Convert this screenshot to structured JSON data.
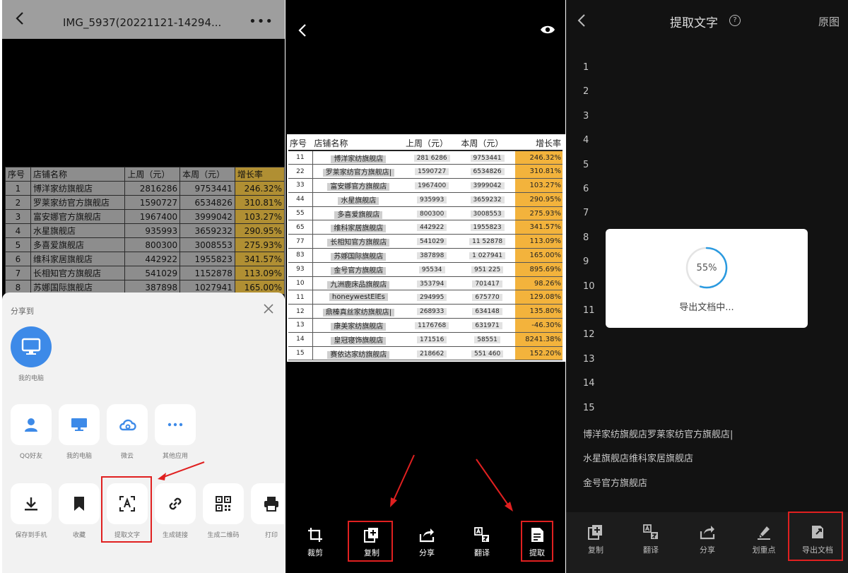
{
  "panel1": {
    "title": "IMG_5937(20221121-14294...",
    "more": "•••",
    "table": {
      "headers": [
        "序号",
        "店铺名称",
        "上周（元）",
        "本周（元）",
        "增长率"
      ],
      "rows": [
        [
          "1",
          "博洋家纺旗舰店",
          "2816286",
          "9753441",
          "246.32%"
        ],
        [
          "2",
          "罗莱家纺官方旗舰店",
          "1590727",
          "6534826",
          "310.81%"
        ],
        [
          "3",
          "富安娜官方旗舰店",
          "1967400",
          "3999042",
          "103.27%"
        ],
        [
          "4",
          "水星旗舰店",
          "935993",
          "3659232",
          "290.95%"
        ],
        [
          "5",
          "多喜爱旗舰店",
          "800300",
          "3008553",
          "275.93%"
        ],
        [
          "6",
          "维科家居旗舰店",
          "442922",
          "1955823",
          "341.57%"
        ],
        [
          "7",
          "长相知官方旗舰店",
          "541029",
          "1152878",
          "113.09%"
        ],
        [
          "8",
          "苏娜国际旗舰店",
          "387898",
          "1027941",
          "165.00%"
        ]
      ]
    },
    "share": {
      "title": "分享到",
      "my_pc": "我的电脑",
      "row1": [
        {
          "label": "QQ好友",
          "icon": "person-icon"
        },
        {
          "label": "我的电脑",
          "icon": "monitor-icon"
        },
        {
          "label": "微云",
          "icon": "cloud-icon"
        },
        {
          "label": "其他应用",
          "icon": "dots-icon"
        }
      ],
      "row2": [
        {
          "label": "保存到手机",
          "icon": "download-icon"
        },
        {
          "label": "收藏",
          "icon": "bookmark-icon"
        },
        {
          "label": "提取文字",
          "icon": "text-scan-icon"
        },
        {
          "label": "生成链接",
          "icon": "link-icon"
        },
        {
          "label": "生成二维码",
          "icon": "qrcode-icon"
        },
        {
          "label": "打印",
          "icon": "printer-icon"
        }
      ]
    }
  },
  "panel2": {
    "table": {
      "headers": [
        "序号",
        "店铺名称",
        "上周（元）",
        "本周（元）",
        "增长率"
      ],
      "rows": [
        [
          "11",
          "博洋家纺旗舰店",
          "281 6286",
          "9753441",
          "246.32%"
        ],
        [
          "22",
          "罗莱家纺官方旗舰店|",
          "1590727",
          "6534826",
          "310.81%"
        ],
        [
          "33",
          "富安娜官方旗舰店",
          "1967400",
          "3999042",
          "103.27%"
        ],
        [
          "44",
          "水星旗舰店",
          "935993",
          "3659232",
          "290.95%"
        ],
        [
          "55",
          "多喜爱旗舰店",
          "800300",
          "3008553",
          "275.93%"
        ],
        [
          "65",
          "维科家居旗舰店",
          "442922",
          "1955823",
          "341.57%"
        ],
        [
          "77",
          "长相知官方旗舰店",
          "541029",
          "11 52878",
          "113.09%"
        ],
        [
          "83",
          "苏娜国际旗舰店",
          "387898",
          "1 027941",
          "165.00%"
        ],
        [
          "93",
          "金号官方旗舰店",
          "95534",
          "951 225",
          "895.69%"
        ],
        [
          "10",
          "九洲鹿床品旗舰店",
          "353794",
          "701417",
          "98.26%"
        ],
        [
          "11",
          "honeywestElEs",
          "294995",
          "675770",
          "129.08%"
        ],
        [
          "12",
          "鼎榛真丝家纺旗舰店|",
          "268933",
          "634148",
          "135.80%"
        ],
        [
          "13",
          "康美家纺旗舰店",
          "1176768",
          "631971",
          "-46.30%"
        ],
        [
          "14",
          "皇冠寝饰旗舰店",
          "171516",
          "58551",
          "8241.38%"
        ],
        [
          "15",
          "赛依达家纺旗舰店",
          "218662",
          "551 460",
          "152.20%"
        ]
      ]
    },
    "toolbar": [
      {
        "label": "裁剪",
        "icon": "crop-icon"
      },
      {
        "label": "复制",
        "icon": "copy-icon"
      },
      {
        "label": "分享",
        "icon": "share-icon"
      },
      {
        "label": "翻译",
        "icon": "translate-icon"
      },
      {
        "label": "提取",
        "icon": "extract-icon"
      }
    ]
  },
  "panel3": {
    "title": "提取文字",
    "help": "?",
    "original": "原图",
    "lines": [
      "1",
      "2",
      "3",
      "4",
      "5",
      "6",
      "7",
      "8",
      "9",
      "10",
      "11",
      "12",
      "13",
      "14",
      "15",
      "博洋家纺旗舰店罗莱家纺官方旗舰店|",
      "水星旗舰店维科家居旗舰店",
      "金号官方旗舰店"
    ],
    "progress": {
      "percent_text": "55%",
      "value": 0.55,
      "message": "导出文档中..."
    },
    "toolbar": [
      {
        "label": "复制",
        "icon": "copy-icon"
      },
      {
        "label": "翻译",
        "icon": "translate-icon"
      },
      {
        "label": "分享",
        "icon": "share-icon"
      },
      {
        "label": "划重点",
        "icon": "highlighter-icon"
      },
      {
        "label": "导出文档",
        "icon": "export-doc-icon"
      }
    ]
  },
  "colors": {
    "accent_blue": "#3d8ae8",
    "highlight_red": "#e02020",
    "growth_orange": "#f3b33c",
    "progress_blue": "#2a9ae0"
  }
}
